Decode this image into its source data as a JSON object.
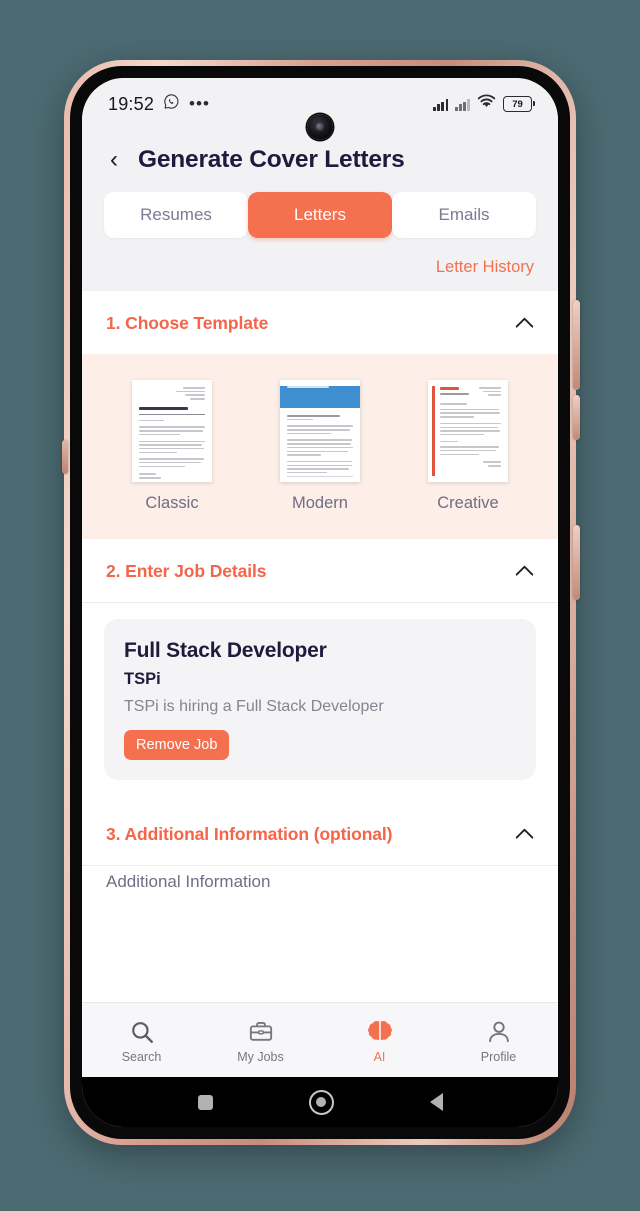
{
  "status_bar": {
    "time": "19:52",
    "whatsapp_icon": "whatsapp-icon",
    "overflow_dots": "•••",
    "signal_icon": "signal-bars-icon",
    "signal_alt_icon": "signal-bars-no-sim-icon",
    "wifi_icon": "wifi-icon",
    "battery_level": "79"
  },
  "header": {
    "back_icon": "‹",
    "title": "Generate Cover Letters"
  },
  "tabs": [
    {
      "label": "Resumes",
      "active": false
    },
    {
      "label": "Letters",
      "active": true
    },
    {
      "label": "Emails",
      "active": false
    }
  ],
  "history": {
    "label": "Letter History"
  },
  "sections": {
    "choose_template": {
      "title": "1. Choose Template",
      "collapse_icon": "chevron-up-icon"
    },
    "job_details": {
      "title": "2. Enter Job Details",
      "collapse_icon": "chevron-up-icon"
    },
    "additional": {
      "title": "3. Additional Information (optional)",
      "collapse_icon": "chevron-up-icon"
    }
  },
  "templates": [
    {
      "label": "Classic",
      "style": "classic"
    },
    {
      "label": "Modern",
      "style": "modern"
    },
    {
      "label": "Creative",
      "style": "creative"
    }
  ],
  "job": {
    "title": "Full Stack Developer",
    "company": "TSPi",
    "description": "TSPi is hiring a Full Stack Developer",
    "remove_label": "Remove Job"
  },
  "additional_info": {
    "field_label": "Additional Information"
  },
  "bottom_nav": [
    {
      "label": "Search",
      "icon": "search-icon",
      "active": false
    },
    {
      "label": "My Jobs",
      "icon": "briefcase-icon",
      "active": false
    },
    {
      "label": "AI",
      "icon": "brain-icon",
      "active": true
    },
    {
      "label": "Profile",
      "icon": "person-icon",
      "active": false
    }
  ],
  "android_nav": {
    "recents_icon": "square-recents-icon",
    "home_icon": "circle-home-icon",
    "back_icon": "triangle-back-icon"
  },
  "colors": {
    "accent": "#f4704e",
    "accent_dark": "#f4654a",
    "title": "#211a3d",
    "page_bg": "#4c6a72",
    "template_bg": "#fdeee8",
    "chrome_bg": "#f2f2f5"
  }
}
